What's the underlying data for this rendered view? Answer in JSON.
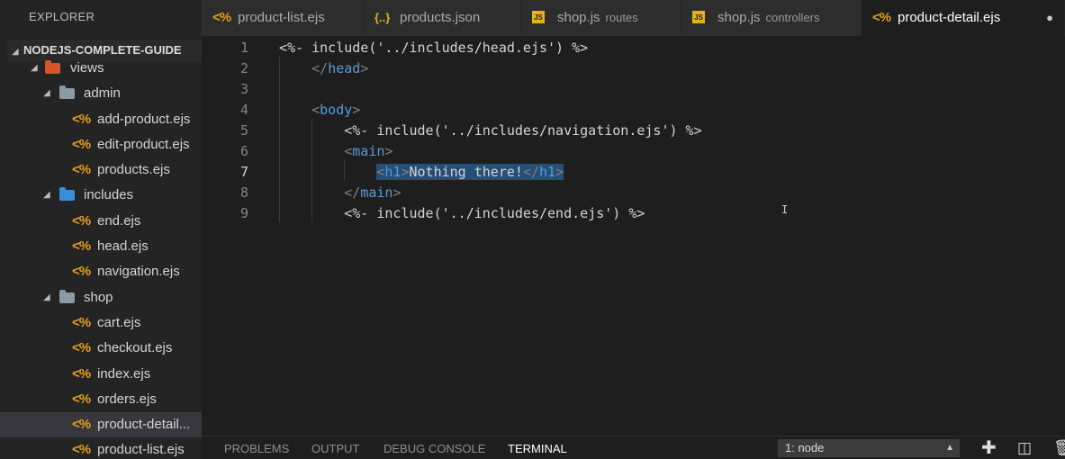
{
  "sidebar": {
    "header": "EXPLORER",
    "project": "NODEJS-COMPLETE-GUIDE",
    "tree": [
      {
        "label": "views",
        "type": "folder",
        "depth": 0,
        "folder_color": "views"
      },
      {
        "label": "admin",
        "type": "folder",
        "depth": 1
      },
      {
        "label": "add-product.ejs",
        "type": "ejs",
        "depth": 2
      },
      {
        "label": "edit-product.ejs",
        "type": "ejs",
        "depth": 2
      },
      {
        "label": "products.ejs",
        "type": "ejs",
        "depth": 2
      },
      {
        "label": "includes",
        "type": "folder",
        "depth": 1,
        "folder_color": "includes"
      },
      {
        "label": "end.ejs",
        "type": "ejs",
        "depth": 2
      },
      {
        "label": "head.ejs",
        "type": "ejs",
        "depth": 2
      },
      {
        "label": "navigation.ejs",
        "type": "ejs",
        "depth": 2
      },
      {
        "label": "shop",
        "type": "folder",
        "depth": 1
      },
      {
        "label": "cart.ejs",
        "type": "ejs",
        "depth": 2
      },
      {
        "label": "checkout.ejs",
        "type": "ejs",
        "depth": 2
      },
      {
        "label": "index.ejs",
        "type": "ejs",
        "depth": 2
      },
      {
        "label": "orders.ejs",
        "type": "ejs",
        "depth": 2
      },
      {
        "label": "product-detail...",
        "type": "ejs",
        "depth": 2,
        "selected": true
      },
      {
        "label": "product-list.ejs",
        "type": "ejs",
        "depth": 2
      }
    ]
  },
  "tabs": [
    {
      "label": "product-list.ejs",
      "sub": "",
      "icon": "ejs"
    },
    {
      "label": "products.json",
      "sub": "",
      "icon": "json"
    },
    {
      "label": "shop.js",
      "sub": "routes",
      "icon": "js"
    },
    {
      "label": "shop.js",
      "sub": "controllers",
      "icon": "js"
    },
    {
      "label": "product-detail.ejs",
      "sub": "",
      "icon": "ejs",
      "active": true,
      "dirty": true
    }
  ],
  "editor": {
    "current_line": 7,
    "lines": [
      {
        "n": "1",
        "text": "<%- include('../includes/head.ejs') %>"
      },
      {
        "n": "2",
        "text": "    </head>"
      },
      {
        "n": "3",
        "text": ""
      },
      {
        "n": "4",
        "text": "    <body>"
      },
      {
        "n": "5",
        "text": "        <%- include('../includes/navigation.ejs') %>"
      },
      {
        "n": "6",
        "text": "        <main>"
      },
      {
        "n": "7",
        "text": "            <h1>Nothing there!</h1>"
      },
      {
        "n": "8",
        "text": "        </main>"
      },
      {
        "n": "9",
        "text": "        <%- include('../includes/end.ejs') %>"
      }
    ]
  },
  "panel": {
    "tabs": [
      "PROBLEMS",
      "OUTPUT",
      "DEBUG CONSOLE",
      "TERMINAL"
    ],
    "active_tab": "TERMINAL",
    "terminal_select": "1: node"
  },
  "colors": {
    "ejs_icon": "#e3a11a",
    "tag": "#569cd6",
    "selection": "#264f78"
  }
}
